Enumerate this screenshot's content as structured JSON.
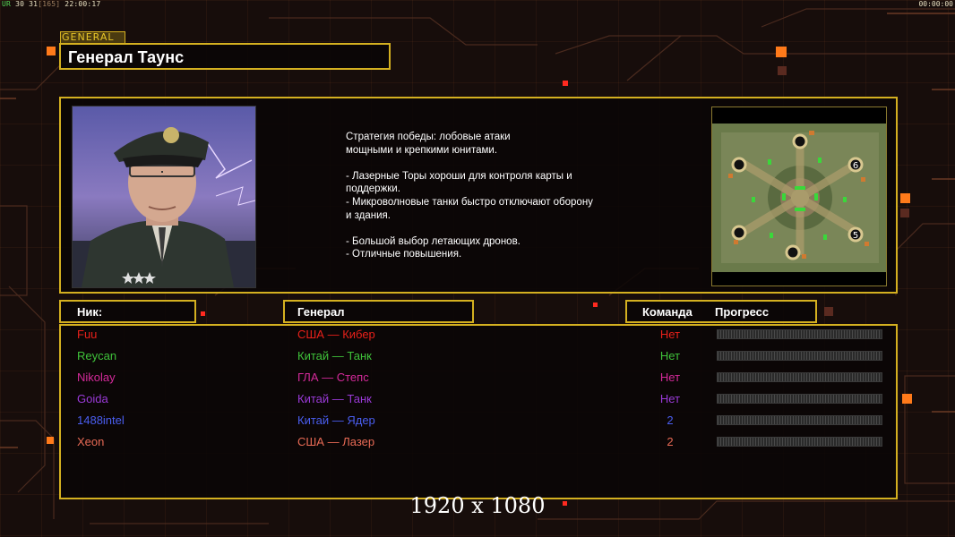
{
  "topbar": {
    "ur_label": "UR",
    "stats": "30 31",
    "bracket": "[165]",
    "clock": "22:00:17",
    "timer": "00:00:00"
  },
  "header": {
    "section_tag": "GENERAL",
    "general_name": "Генерал Таунс"
  },
  "description": {
    "text": "Стратегия победы: лобовые атаки\nмощными и крепкими юнитами.\n\n- Лазерные Торы хороши для контроля карты и\n поддержки.\n- Микроволновые танки быстро отключают оборону\n и здания.\n\n- Большой выбор летающих дронов.\n- Отличные повышения."
  },
  "map": {
    "slot_labels": [
      "6",
      "5"
    ]
  },
  "columns": {
    "nick": "Ник:",
    "general": "Генерал",
    "team": "Команда",
    "progress": "Прогресс"
  },
  "players": [
    {
      "nick": "Fuu",
      "general": "США — Кибер",
      "team": "Нет",
      "color": "#e8201a",
      "progress": 0
    },
    {
      "nick": "Reycan",
      "general": "Китай — Танк",
      "team": "Нет",
      "color": "#3fc23a",
      "progress": 0
    },
    {
      "nick": "Nikolay",
      "general": "ГЛА — Степс",
      "team": "Нет",
      "color": "#d42a9a",
      "progress": 0
    },
    {
      "nick": "Goida",
      "general": "Китай — Танк",
      "team": "Нет",
      "color": "#9a3ad8",
      "progress": 0
    },
    {
      "nick": "1488intel",
      "general": "Китай — Ядер",
      "team": "2",
      "color": "#4a5ef0",
      "progress": 0
    },
    {
      "nick": "Xeon",
      "general": "США — Лазер",
      "team": "2",
      "color": "#e86a55",
      "progress": 0
    }
  ],
  "footer": {
    "resolution": "1920 x 1080"
  },
  "colors": {
    "frame": "#d4b020",
    "accent": "#ff7a1a"
  }
}
